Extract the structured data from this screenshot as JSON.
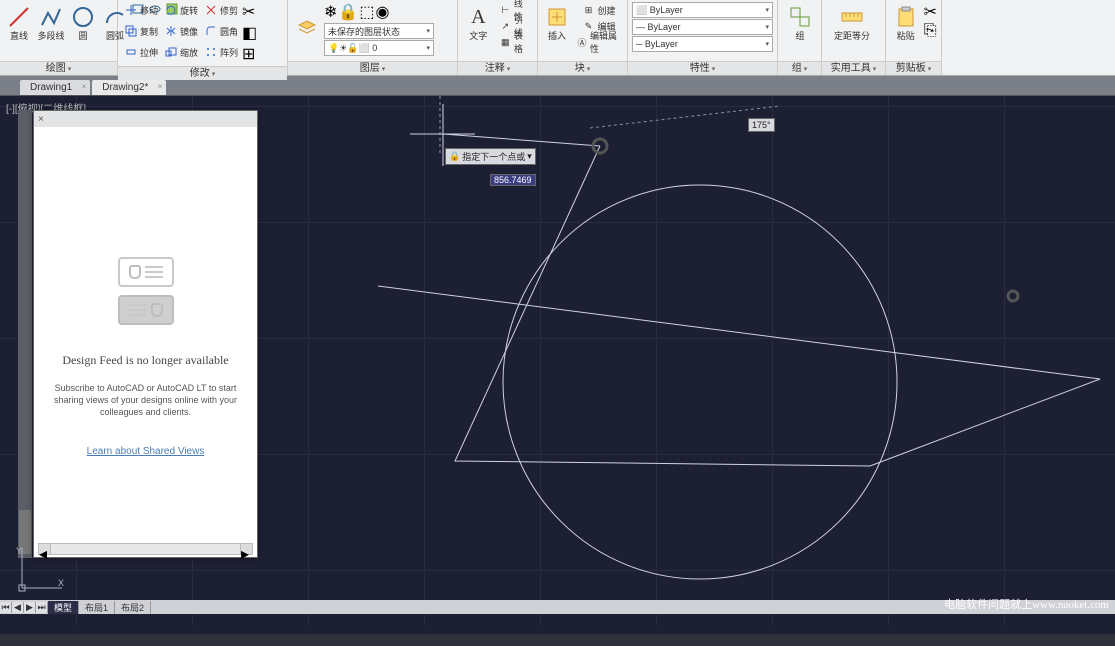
{
  "ribbon": {
    "panels": {
      "draw": {
        "title": "绘图",
        "line": "直线",
        "polyline": "多段线",
        "circle": "圆",
        "arc": "圆弧"
      },
      "modify": {
        "title": "修改",
        "move": "移动",
        "copy": "复制",
        "stretch": "拉伸",
        "rotate": "旋转",
        "mirror": "镜像",
        "scale": "缩放",
        "trim": "修剪",
        "fillet": "圆角",
        "array": "阵列"
      },
      "layers": {
        "title": "图层",
        "state": "未保存的图层状态",
        "current": "0"
      },
      "annotate": {
        "title": "注释",
        "text": "文字",
        "linear": "线性",
        "leader": "引线",
        "table": "表格"
      },
      "block": {
        "title": "块",
        "insert": "插入",
        "create": "创建",
        "edit": "编辑",
        "attr": "编辑属性"
      },
      "props": {
        "title": "特性",
        "color": "ByLayer",
        "lw": "ByLayer",
        "lt": "ByLayer"
      },
      "group": {
        "title": "组",
        "label": "组"
      },
      "util": {
        "title": "实用工具",
        "measure": "定距等分"
      },
      "clip": {
        "title": "剪贴板",
        "paste": "粘贴"
      }
    }
  },
  "tabs": {
    "t1": "Drawing1",
    "t2": "Drawing2*"
  },
  "viewport": "[-][俯视][二维线框]",
  "feed": {
    "title": "Design Feed is no longer available",
    "sub": "Subscribe to AutoCAD or AutoCAD LT to start sharing views of your designs online with your colleagues and clients.",
    "link": "Learn about Shared Views"
  },
  "dynamic": {
    "prompt": "指定下一个点或",
    "coord": "856.7469",
    "angle": "175°"
  },
  "ucs": {
    "x": "X",
    "y": "Y"
  },
  "bottom": {
    "model": "模型",
    "l1": "布局1",
    "l2": "布局2"
  },
  "watermark": "电脑软件问题就上www.naoket.com"
}
